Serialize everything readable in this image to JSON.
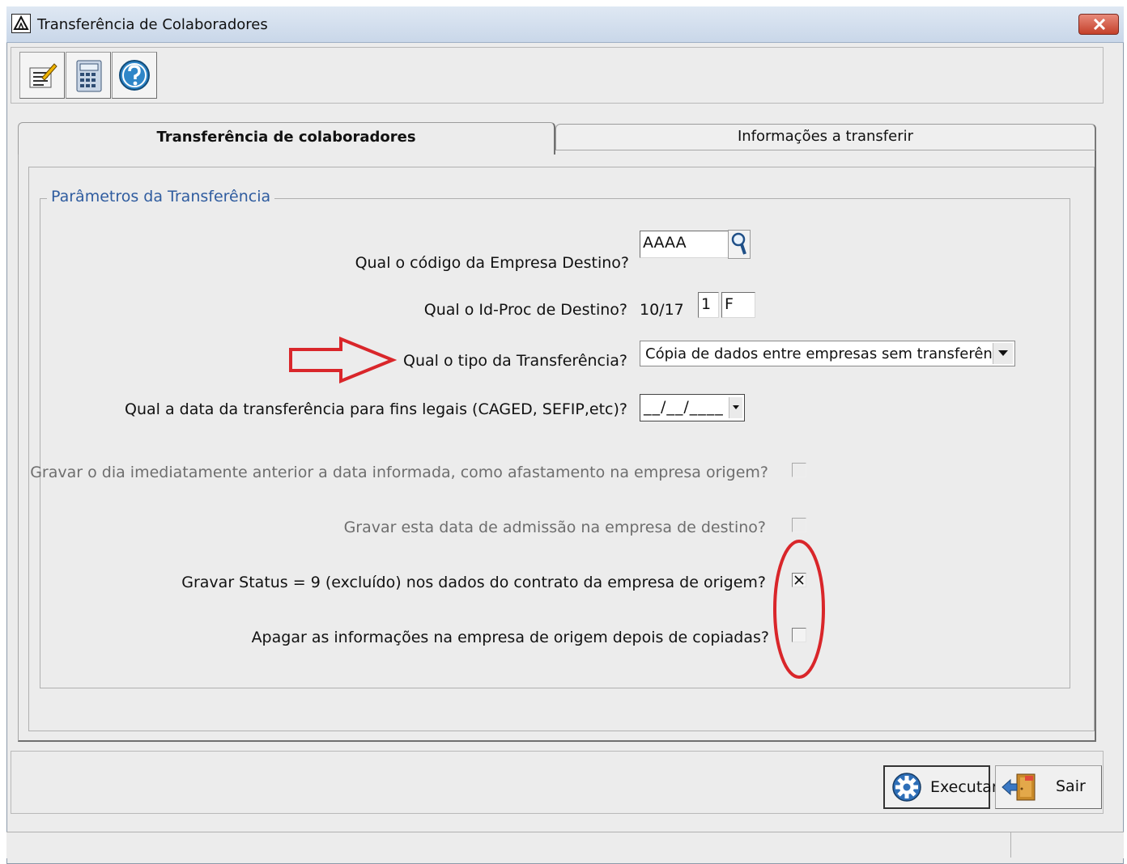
{
  "window": {
    "title": "Transferência de Colaboradores"
  },
  "toolbar": {
    "buttons": [
      {
        "name": "edit-notes-icon"
      },
      {
        "name": "calculator-icon"
      },
      {
        "name": "help-icon"
      }
    ]
  },
  "tabs": [
    {
      "label": "Transferência de colaboradores",
      "active": true
    },
    {
      "label": "Informações a transferir",
      "active": false
    }
  ],
  "group": {
    "title": "Parâmetros da Transferência",
    "fields": {
      "empresa_label": "Qual o código da Empresa Destino?",
      "empresa_value": "AAAA",
      "idproc_label": "Qual o Id-Proc de Destino?",
      "idproc_prefix": "10/17",
      "idproc_num": "1",
      "idproc_letter": "F",
      "tipo_label": "Qual o tipo da Transferência?",
      "tipo_value": "Cópia de dados entre empresas sem transferência",
      "data_label": "Qual a data da transferência para fins legais (CAGED, SEFIP,etc)?",
      "data_value": "__/__/____",
      "chk1_label": "Gravar o dia imediatamente anterior a data informada, como afastamento na empresa origem?",
      "chk1_checked": false,
      "chk2_label": "Gravar esta data de admissão na empresa de destino?",
      "chk2_checked": false,
      "chk3_label": "Gravar Status = 9 (excluído) nos dados do contrato da empresa de origem?",
      "chk3_checked": true,
      "chk4_label": "Apagar as informações na empresa de origem depois de copiadas?",
      "chk4_checked": false
    }
  },
  "buttons": {
    "executar": "Executar",
    "sair": "Sair"
  },
  "colors": {
    "group_title": "#2f5c9f",
    "annotation": "#d9262a"
  }
}
